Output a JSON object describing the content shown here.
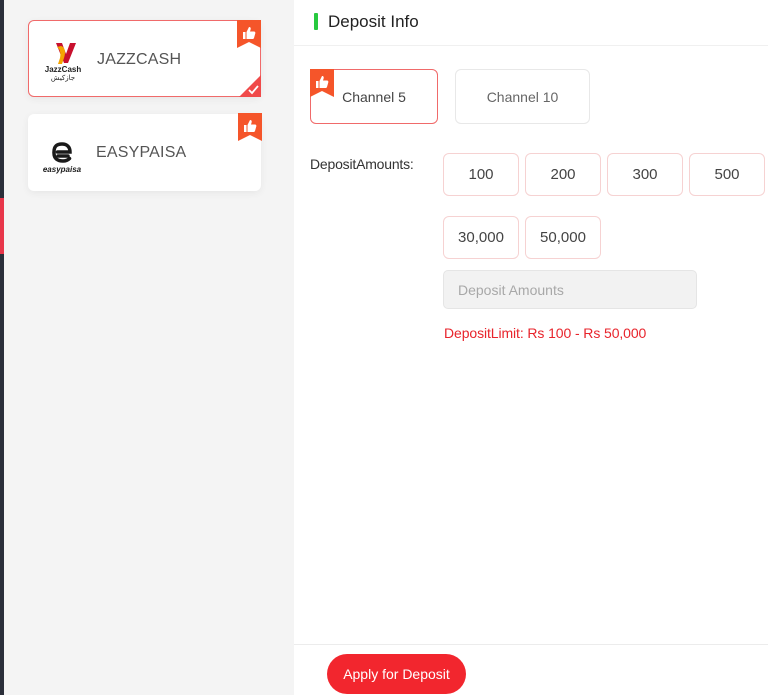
{
  "colors": {
    "accent": "#f2262e",
    "active_border": "#f06a6a",
    "limit_text": "#e8242c",
    "header_bar": "#27c93f",
    "badge": "#f5552a"
  },
  "payment_methods": [
    {
      "label": "JAZZCASH",
      "logo_icon": "jazzcash-logo-icon",
      "recommended": true,
      "selected": true
    },
    {
      "label": "EASYPAISA",
      "logo_icon": "easypaisa-logo-icon",
      "recommended": true,
      "selected": false
    }
  ],
  "deposit": {
    "title": "Deposit Info",
    "channels": [
      {
        "label": "Channel 5",
        "active": true,
        "recommended": true
      },
      {
        "label": "Channel 10",
        "active": false,
        "recommended": false
      }
    ],
    "amounts_label": "DepositAmounts:",
    "amounts": [
      "100",
      "200",
      "300",
      "500",
      "30,000",
      "50,000"
    ],
    "input_placeholder": "Deposit Amounts",
    "limit": "DepositLimit: Rs 100 - Rs 50,000",
    "apply_label": "Apply for Deposit"
  }
}
